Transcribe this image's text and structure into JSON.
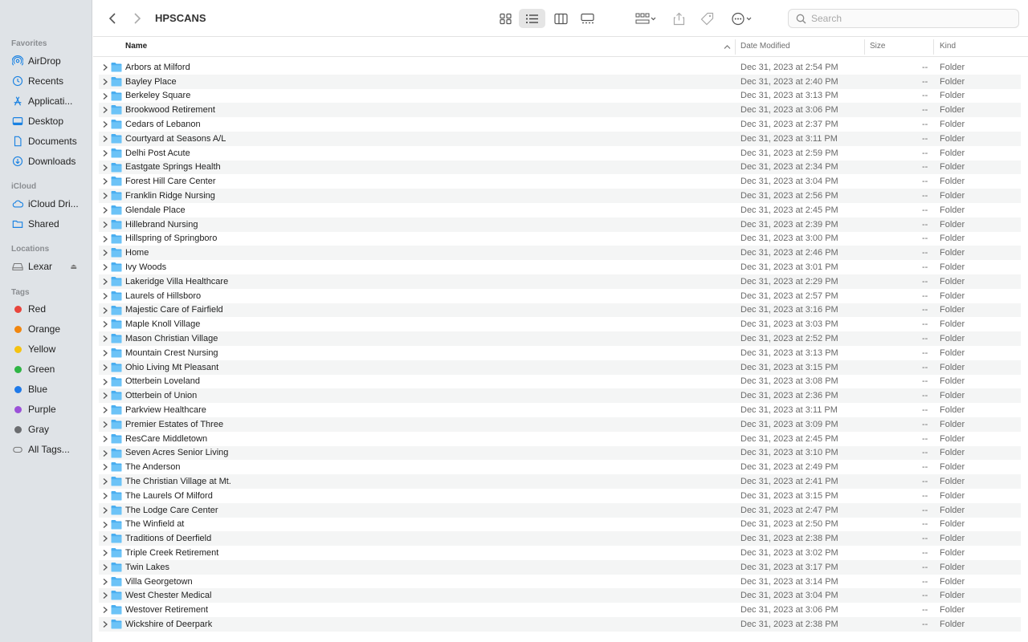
{
  "sidebar": {
    "favorites_heading": "Favorites",
    "favorites": [
      {
        "label": "AirDrop",
        "icon": "airdrop-icon"
      },
      {
        "label": "Recents",
        "icon": "clock-icon"
      },
      {
        "label": "Applicati...",
        "icon": "applications-icon"
      },
      {
        "label": "Desktop",
        "icon": "desktop-icon"
      },
      {
        "label": "Documents",
        "icon": "document-icon"
      },
      {
        "label": "Downloads",
        "icon": "download-icon"
      }
    ],
    "icloud_heading": "iCloud",
    "icloud": [
      {
        "label": "iCloud Dri...",
        "icon": "cloud-icon"
      },
      {
        "label": "Shared",
        "icon": "shared-folder-icon"
      }
    ],
    "locations_heading": "Locations",
    "locations": [
      {
        "label": "Lexar",
        "icon": "external-drive-icon"
      }
    ],
    "eject_glyph": "⏏",
    "tags_heading": "Tags",
    "tags": [
      {
        "label": "Red",
        "color": "#e8453c"
      },
      {
        "label": "Orange",
        "color": "#f0860f"
      },
      {
        "label": "Yellow",
        "color": "#f5c211"
      },
      {
        "label": "Green",
        "color": "#2fb545"
      },
      {
        "label": "Blue",
        "color": "#1f7ae9"
      },
      {
        "label": "Purple",
        "color": "#9b51d8"
      },
      {
        "label": "Gray",
        "color": "#6b6d70"
      }
    ],
    "all_tags": "All Tags..."
  },
  "toolbar": {
    "title": "HPSCANS",
    "search_placeholder": "Search",
    "accent": "#1a82e2"
  },
  "columns": {
    "name": "Name",
    "date": "Date Modified",
    "size": "Size",
    "kind": "Kind"
  },
  "files": [
    {
      "name": "Arbors at Milford",
      "date": "Dec 31, 2023 at 2:54 PM",
      "size": "--",
      "kind": "Folder"
    },
    {
      "name": "Bayley Place",
      "date": "Dec 31, 2023 at 2:40 PM",
      "size": "--",
      "kind": "Folder"
    },
    {
      "name": "Berkeley Square",
      "date": "Dec 31, 2023 at 3:13 PM",
      "size": "--",
      "kind": "Folder"
    },
    {
      "name": "Brookwood Retirement",
      "date": "Dec 31, 2023 at 3:06 PM",
      "size": "--",
      "kind": "Folder"
    },
    {
      "name": "Cedars of Lebanon",
      "date": "Dec 31, 2023 at 2:37 PM",
      "size": "--",
      "kind": "Folder"
    },
    {
      "name": "Courtyard at Seasons A/L",
      "date": "Dec 31, 2023 at 3:11 PM",
      "size": "--",
      "kind": "Folder"
    },
    {
      "name": "Delhi Post Acute",
      "date": "Dec 31, 2023 at 2:59 PM",
      "size": "--",
      "kind": "Folder"
    },
    {
      "name": "Eastgate Springs Health",
      "date": "Dec 31, 2023 at 2:34 PM",
      "size": "--",
      "kind": "Folder"
    },
    {
      "name": "Forest Hill Care Center",
      "date": "Dec 31, 2023 at 3:04 PM",
      "size": "--",
      "kind": "Folder"
    },
    {
      "name": "Franklin Ridge Nursing",
      "date": "Dec 31, 2023 at 2:56 PM",
      "size": "--",
      "kind": "Folder"
    },
    {
      "name": "Glendale Place",
      "date": "Dec 31, 2023 at 2:45 PM",
      "size": "--",
      "kind": "Folder"
    },
    {
      "name": "Hillebrand Nursing",
      "date": "Dec 31, 2023 at 2:39 PM",
      "size": "--",
      "kind": "Folder"
    },
    {
      "name": "Hillspring of Springboro",
      "date": "Dec 31, 2023 at 3:00 PM",
      "size": "--",
      "kind": "Folder"
    },
    {
      "name": "Home",
      "date": "Dec 31, 2023 at 2:46 PM",
      "size": "--",
      "kind": "Folder"
    },
    {
      "name": "Ivy Woods",
      "date": "Dec 31, 2023 at 3:01 PM",
      "size": "--",
      "kind": "Folder"
    },
    {
      "name": "Lakeridge Villa Healthcare",
      "date": "Dec 31, 2023 at 2:29 PM",
      "size": "--",
      "kind": "Folder"
    },
    {
      "name": "Laurels of Hillsboro",
      "date": "Dec 31, 2023 at 2:57 PM",
      "size": "--",
      "kind": "Folder"
    },
    {
      "name": "Majestic Care of Fairfield",
      "date": "Dec 31, 2023 at 3:16 PM",
      "size": "--",
      "kind": "Folder"
    },
    {
      "name": "Maple Knoll Village",
      "date": "Dec 31, 2023 at 3:03 PM",
      "size": "--",
      "kind": "Folder"
    },
    {
      "name": "Mason Christian Village",
      "date": "Dec 31, 2023 at 2:52 PM",
      "size": "--",
      "kind": "Folder"
    },
    {
      "name": "Mountain Crest Nursing",
      "date": "Dec 31, 2023 at 3:13 PM",
      "size": "--",
      "kind": "Folder"
    },
    {
      "name": "Ohio Living Mt Pleasant",
      "date": "Dec 31, 2023 at 3:15 PM",
      "size": "--",
      "kind": "Folder"
    },
    {
      "name": "Otterbein Loveland",
      "date": "Dec 31, 2023 at 3:08 PM",
      "size": "--",
      "kind": "Folder"
    },
    {
      "name": "Otterbein of Union",
      "date": "Dec 31, 2023 at 2:36 PM",
      "size": "--",
      "kind": "Folder"
    },
    {
      "name": "Parkview Healthcare",
      "date": "Dec 31, 2023 at 3:11 PM",
      "size": "--",
      "kind": "Folder"
    },
    {
      "name": "Premier Estates of Three",
      "date": "Dec 31, 2023 at 3:09 PM",
      "size": "--",
      "kind": "Folder"
    },
    {
      "name": "ResCare Middletown",
      "date": "Dec 31, 2023 at 2:45 PM",
      "size": "--",
      "kind": "Folder"
    },
    {
      "name": "Seven Acres Senior Living",
      "date": "Dec 31, 2023 at 3:10 PM",
      "size": "--",
      "kind": "Folder"
    },
    {
      "name": "The Anderson",
      "date": "Dec 31, 2023 at 2:49 PM",
      "size": "--",
      "kind": "Folder"
    },
    {
      "name": "The Christian Village at Mt.",
      "date": "Dec 31, 2023 at 2:41 PM",
      "size": "--",
      "kind": "Folder"
    },
    {
      "name": "The Laurels Of Milford",
      "date": "Dec 31, 2023 at 3:15 PM",
      "size": "--",
      "kind": "Folder"
    },
    {
      "name": "The Lodge Care Center",
      "date": "Dec 31, 2023 at 2:47 PM",
      "size": "--",
      "kind": "Folder"
    },
    {
      "name": "The Winfield at",
      "date": "Dec 31, 2023 at 2:50 PM",
      "size": "--",
      "kind": "Folder"
    },
    {
      "name": "Traditions of Deerfield",
      "date": "Dec 31, 2023 at 2:38 PM",
      "size": "--",
      "kind": "Folder"
    },
    {
      "name": "Triple Creek Retirement",
      "date": "Dec 31, 2023 at 3:02 PM",
      "size": "--",
      "kind": "Folder"
    },
    {
      "name": "Twin Lakes",
      "date": "Dec 31, 2023 at 3:17 PM",
      "size": "--",
      "kind": "Folder"
    },
    {
      "name": "Villa Georgetown",
      "date": "Dec 31, 2023 at 3:14 PM",
      "size": "--",
      "kind": "Folder"
    },
    {
      "name": "West Chester Medical",
      "date": "Dec 31, 2023 at 3:04 PM",
      "size": "--",
      "kind": "Folder"
    },
    {
      "name": "Westover Retirement",
      "date": "Dec 31, 2023 at 3:06 PM",
      "size": "--",
      "kind": "Folder"
    },
    {
      "name": "Wickshire of Deerpark",
      "date": "Dec 31, 2023 at 2:38 PM",
      "size": "--",
      "kind": "Folder"
    }
  ]
}
